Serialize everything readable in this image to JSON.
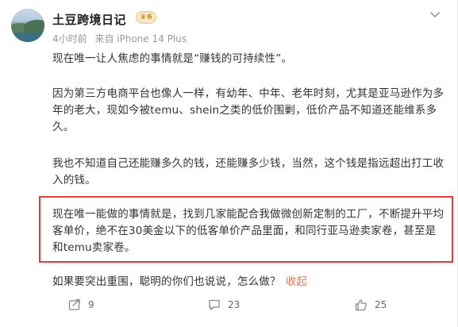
{
  "header": {
    "name": "土豆跨境日记",
    "badge_text": "6",
    "time": "4小时前",
    "source": "来自 iPhone 14 Plus"
  },
  "post": {
    "p1": "现在唯一让人焦虑的事情就是“赚钱的可持续性”。",
    "p2": "因为第三方电商平台也像人一样，有幼年、中年、老年时刻，尤其是亚马逊作为多年的老大，现如今被temu、shein之类的低价围剿，低价产品不知道还能维系多久。",
    "p3": "我也不知道自己还能赚多久的钱，还能赚多少钱，当然，这个钱是指远超出打工收入的钱。",
    "p4": "现在唯一能做的事情就是，找到几家能配合我做微创新定制的工厂，不断提升平均客单价，绝不在30美金以下的低客单价产品里面，和同行亚马逊卖家卷，甚至是和temu卖家卷。",
    "p5": "如果要突出重围，聪明的你们也说说，怎么做？",
    "collapse": "收起"
  },
  "actions": {
    "share_count": "9",
    "comment_count": "23",
    "like_count": "25"
  },
  "icons": {
    "share": "share-icon",
    "comment": "comment-icon",
    "like": "thumbs-up-icon",
    "more": "chevron-down-icon",
    "badge": "crown-icon"
  },
  "colors": {
    "highlight_border": "#e03c3c",
    "collapse_link": "#eb7350",
    "badge_fill": "#f7e7c6",
    "badge_text": "#c48a1e"
  }
}
